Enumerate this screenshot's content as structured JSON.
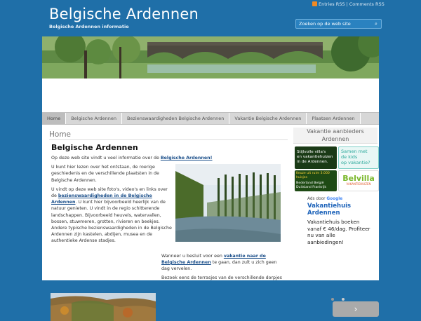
{
  "header": {
    "site_title": "Belgische Ardennen",
    "tagline": "Belgische Ardennen informatie",
    "rss_entries": "Entries RSS",
    "rss_separator": "|",
    "rss_comments": "Comments RSS",
    "search_placeholder": "Zoeken op de web site"
  },
  "nav": {
    "items": [
      {
        "label": "Home",
        "active": true
      },
      {
        "label": "Belgische Ardennen"
      },
      {
        "label": "Bezienswaardigheden Belgische Ardennen"
      },
      {
        "label": "Vakantie Belgische Ardennen"
      },
      {
        "label": "Plaatsen Ardennen"
      }
    ]
  },
  "main": {
    "breadcrumb": "Home",
    "title": "Belgische Ardennen",
    "p1_text": "Op deze web site vindt u veel informatie over de ",
    "p1_link": "Belgische Ardennen!",
    "p2": "U kunt hier lezen over het ontstaan, de roerige geschiedenis en de verschillende plaatsten in de Belgische Ardennen.",
    "p3_a": "U vindt op deze web site foto's, video's en links over de ",
    "p3_link": "bezienswaardigheden in de Belgische Ardennen",
    "p3_b": ". U kunt hier bijvoorbeeld heerlijk van de natuur genieten. U vindt in de regio schitterende landschappen. Bijvoorbeeld heuvels, watervallen, bossen, stuwmeren, grotten, rivieren en beekjes. Andere typische bezienswaardigheden in de Belgische Ardennen zijn kastelen, abdijen, musea en de authentieke Ardense stadjes.",
    "p4_a": "Wanneer u besluit voor een ",
    "p4_link": "vakantie naar de Belgische Ardennen",
    "p4_b": " te gaan, dan zult u zich geen dag vervelen.",
    "p5": "Bezoek eens de terrasjes van de verschillende dorpjes"
  },
  "sidebar": {
    "heading": "Vakantie aanbieders Ardennen",
    "ad1_line1": "Stijlvolle villa's",
    "ad1_line2": "en vakantiehuizen",
    "ad1_line3": "in de Ardennen.",
    "ad2_line1": "Samen met",
    "ad2_line2": "de kids",
    "ad2_line3": "op vakantie?",
    "ad3_line1": "Keuze uit ruim 3.000 huisjes",
    "ad3_line2": "Nederland België",
    "ad3_line3": "Duitsland Frankrijk",
    "ad4_brand": "Belvilla",
    "ad4_sub": "VAKANTIEHUIZEN",
    "ads_by": "Ads door",
    "ads_google": "Google",
    "ad_title": "Vakantiehuis Ardennen",
    "ad_body": "Vakantiehuis boeken vanaf € 46/dag. Profiteer nu van alle aanbiedingen!",
    "next_label": "›"
  }
}
